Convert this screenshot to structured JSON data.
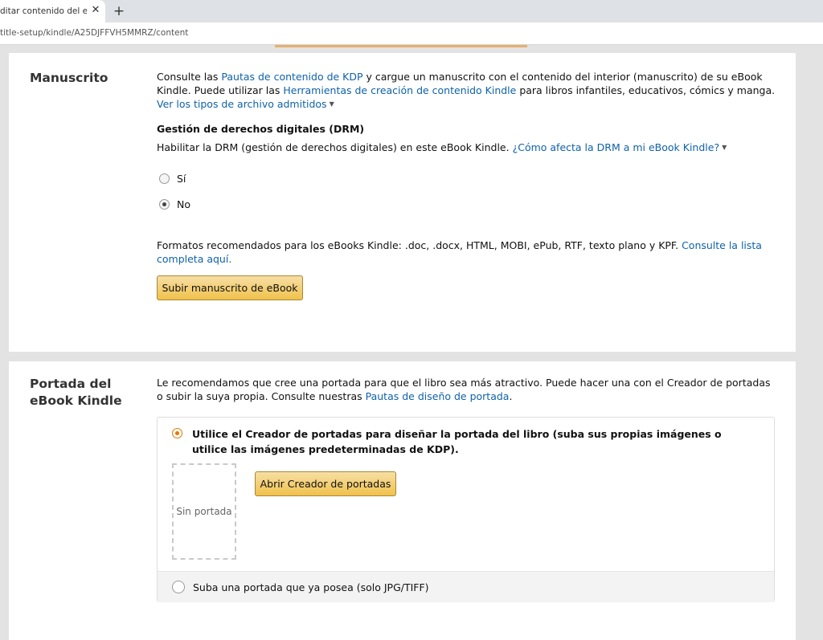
{
  "browser": {
    "tab_title": "ditar contenido del eBook",
    "tab_close": "✕",
    "new_tab": "+",
    "url": "title-setup/kindle/A25DJFFVH5MMRZ/content"
  },
  "manuscript": {
    "title": "Manuscrito",
    "intro_1": "Consulte las ",
    "intro_link_guidelines": "Pautas de contenido de KDP",
    "intro_2": " y cargue un manuscrito con el contenido del interior (manuscrito) de su eBook Kindle. Puede utilizar las ",
    "intro_link_tools": "Herramientas de creación de contenido Kindle",
    "intro_3": " para libros infantiles, educativos, cómics y manga. ",
    "intro_link_types": "Ver los tipos de archivo admitidos",
    "drm_heading": "Gestión de derechos digitales (DRM)",
    "drm_desc": "Habilitar la DRM (gestión de derechos digitales) en este eBook Kindle. ",
    "drm_link": "¿Cómo afecta la DRM a mi eBook Kindle?",
    "drm_options": [
      {
        "label": "Sí",
        "checked": false
      },
      {
        "label": "No",
        "checked": true
      }
    ],
    "formats_text": "Formatos recomendados para los eBooks Kindle: .doc, .docx, HTML, MOBI, ePub, RTF, texto plano y KPF. ",
    "formats_link": "Consulte la lista completa aquí.",
    "upload_button": "Subir manuscrito de eBook"
  },
  "cover": {
    "title": "Portada del eBook Kindle",
    "intro": "Le recomendamos que cree una portada para que el libro sea más atractivo. Puede hacer una con el Creador de portadas o subir la suya propia. Consulte nuestras ",
    "intro_link": "Pautas de diseño de portada",
    "intro_end": ".",
    "option_creator": "Utilice el Creador de portadas para diseñar la portada del libro (suba sus propias imágenes o utilice las imágenes predeterminadas de KDP).",
    "no_cover": "Sin portada",
    "creator_button": "Abrir Creador de portadas",
    "option_upload": "Suba una portada que ya posea (solo JPG/TIFF)",
    "selected_option": "creator"
  },
  "colors": {
    "link": "#0f62a8",
    "button_yellow": "#f0c14b",
    "radio_selected": "#e77600",
    "page_background": "#e3e3e3"
  }
}
